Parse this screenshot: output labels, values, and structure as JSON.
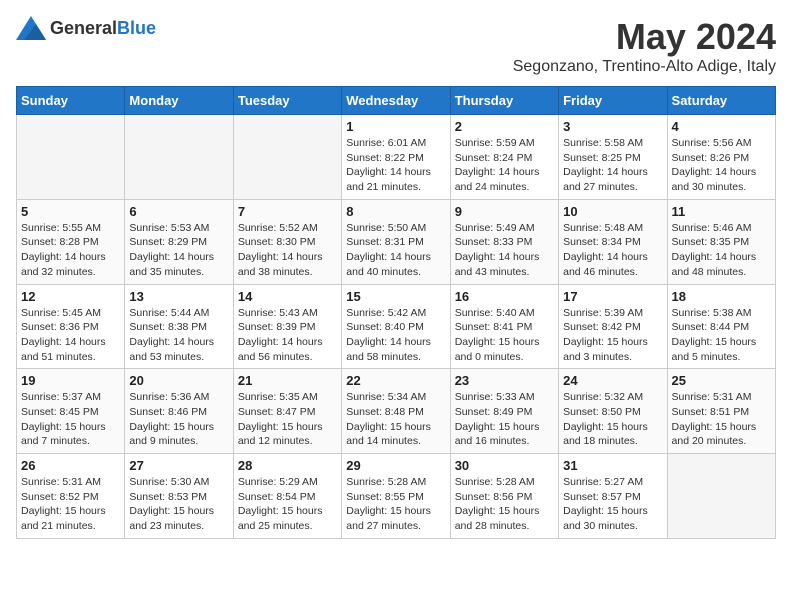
{
  "logo": {
    "general": "General",
    "blue": "Blue"
  },
  "title": "May 2024",
  "location": "Segonzano, Trentino-Alto Adige, Italy",
  "weekdays": [
    "Sunday",
    "Monday",
    "Tuesday",
    "Wednesday",
    "Thursday",
    "Friday",
    "Saturday"
  ],
  "weeks": [
    [
      {
        "day": "",
        "sunrise": "",
        "sunset": "",
        "daylight": ""
      },
      {
        "day": "",
        "sunrise": "",
        "sunset": "",
        "daylight": ""
      },
      {
        "day": "",
        "sunrise": "",
        "sunset": "",
        "daylight": ""
      },
      {
        "day": "1",
        "sunrise": "Sunrise: 6:01 AM",
        "sunset": "Sunset: 8:22 PM",
        "daylight": "Daylight: 14 hours and 21 minutes."
      },
      {
        "day": "2",
        "sunrise": "Sunrise: 5:59 AM",
        "sunset": "Sunset: 8:24 PM",
        "daylight": "Daylight: 14 hours and 24 minutes."
      },
      {
        "day": "3",
        "sunrise": "Sunrise: 5:58 AM",
        "sunset": "Sunset: 8:25 PM",
        "daylight": "Daylight: 14 hours and 27 minutes."
      },
      {
        "day": "4",
        "sunrise": "Sunrise: 5:56 AM",
        "sunset": "Sunset: 8:26 PM",
        "daylight": "Daylight: 14 hours and 30 minutes."
      }
    ],
    [
      {
        "day": "5",
        "sunrise": "Sunrise: 5:55 AM",
        "sunset": "Sunset: 8:28 PM",
        "daylight": "Daylight: 14 hours and 32 minutes."
      },
      {
        "day": "6",
        "sunrise": "Sunrise: 5:53 AM",
        "sunset": "Sunset: 8:29 PM",
        "daylight": "Daylight: 14 hours and 35 minutes."
      },
      {
        "day": "7",
        "sunrise": "Sunrise: 5:52 AM",
        "sunset": "Sunset: 8:30 PM",
        "daylight": "Daylight: 14 hours and 38 minutes."
      },
      {
        "day": "8",
        "sunrise": "Sunrise: 5:50 AM",
        "sunset": "Sunset: 8:31 PM",
        "daylight": "Daylight: 14 hours and 40 minutes."
      },
      {
        "day": "9",
        "sunrise": "Sunrise: 5:49 AM",
        "sunset": "Sunset: 8:33 PM",
        "daylight": "Daylight: 14 hours and 43 minutes."
      },
      {
        "day": "10",
        "sunrise": "Sunrise: 5:48 AM",
        "sunset": "Sunset: 8:34 PM",
        "daylight": "Daylight: 14 hours and 46 minutes."
      },
      {
        "day": "11",
        "sunrise": "Sunrise: 5:46 AM",
        "sunset": "Sunset: 8:35 PM",
        "daylight": "Daylight: 14 hours and 48 minutes."
      }
    ],
    [
      {
        "day": "12",
        "sunrise": "Sunrise: 5:45 AM",
        "sunset": "Sunset: 8:36 PM",
        "daylight": "Daylight: 14 hours and 51 minutes."
      },
      {
        "day": "13",
        "sunrise": "Sunrise: 5:44 AM",
        "sunset": "Sunset: 8:38 PM",
        "daylight": "Daylight: 14 hours and 53 minutes."
      },
      {
        "day": "14",
        "sunrise": "Sunrise: 5:43 AM",
        "sunset": "Sunset: 8:39 PM",
        "daylight": "Daylight: 14 hours and 56 minutes."
      },
      {
        "day": "15",
        "sunrise": "Sunrise: 5:42 AM",
        "sunset": "Sunset: 8:40 PM",
        "daylight": "Daylight: 14 hours and 58 minutes."
      },
      {
        "day": "16",
        "sunrise": "Sunrise: 5:40 AM",
        "sunset": "Sunset: 8:41 PM",
        "daylight": "Daylight: 15 hours and 0 minutes."
      },
      {
        "day": "17",
        "sunrise": "Sunrise: 5:39 AM",
        "sunset": "Sunset: 8:42 PM",
        "daylight": "Daylight: 15 hours and 3 minutes."
      },
      {
        "day": "18",
        "sunrise": "Sunrise: 5:38 AM",
        "sunset": "Sunset: 8:44 PM",
        "daylight": "Daylight: 15 hours and 5 minutes."
      }
    ],
    [
      {
        "day": "19",
        "sunrise": "Sunrise: 5:37 AM",
        "sunset": "Sunset: 8:45 PM",
        "daylight": "Daylight: 15 hours and 7 minutes."
      },
      {
        "day": "20",
        "sunrise": "Sunrise: 5:36 AM",
        "sunset": "Sunset: 8:46 PM",
        "daylight": "Daylight: 15 hours and 9 minutes."
      },
      {
        "day": "21",
        "sunrise": "Sunrise: 5:35 AM",
        "sunset": "Sunset: 8:47 PM",
        "daylight": "Daylight: 15 hours and 12 minutes."
      },
      {
        "day": "22",
        "sunrise": "Sunrise: 5:34 AM",
        "sunset": "Sunset: 8:48 PM",
        "daylight": "Daylight: 15 hours and 14 minutes."
      },
      {
        "day": "23",
        "sunrise": "Sunrise: 5:33 AM",
        "sunset": "Sunset: 8:49 PM",
        "daylight": "Daylight: 15 hours and 16 minutes."
      },
      {
        "day": "24",
        "sunrise": "Sunrise: 5:32 AM",
        "sunset": "Sunset: 8:50 PM",
        "daylight": "Daylight: 15 hours and 18 minutes."
      },
      {
        "day": "25",
        "sunrise": "Sunrise: 5:31 AM",
        "sunset": "Sunset: 8:51 PM",
        "daylight": "Daylight: 15 hours and 20 minutes."
      }
    ],
    [
      {
        "day": "26",
        "sunrise": "Sunrise: 5:31 AM",
        "sunset": "Sunset: 8:52 PM",
        "daylight": "Daylight: 15 hours and 21 minutes."
      },
      {
        "day": "27",
        "sunrise": "Sunrise: 5:30 AM",
        "sunset": "Sunset: 8:53 PM",
        "daylight": "Daylight: 15 hours and 23 minutes."
      },
      {
        "day": "28",
        "sunrise": "Sunrise: 5:29 AM",
        "sunset": "Sunset: 8:54 PM",
        "daylight": "Daylight: 15 hours and 25 minutes."
      },
      {
        "day": "29",
        "sunrise": "Sunrise: 5:28 AM",
        "sunset": "Sunset: 8:55 PM",
        "daylight": "Daylight: 15 hours and 27 minutes."
      },
      {
        "day": "30",
        "sunrise": "Sunrise: 5:28 AM",
        "sunset": "Sunset: 8:56 PM",
        "daylight": "Daylight: 15 hours and 28 minutes."
      },
      {
        "day": "31",
        "sunrise": "Sunrise: 5:27 AM",
        "sunset": "Sunset: 8:57 PM",
        "daylight": "Daylight: 15 hours and 30 minutes."
      },
      {
        "day": "",
        "sunrise": "",
        "sunset": "",
        "daylight": ""
      }
    ]
  ]
}
